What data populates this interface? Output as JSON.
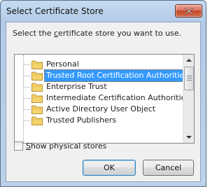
{
  "window": {
    "title": "Select Certificate Store"
  },
  "prompt": {
    "before": "Select the ",
    "underlined": "c",
    "after": "ertificate store you want to use."
  },
  "stores": [
    {
      "label": "Personal",
      "selected": false
    },
    {
      "label": "Trusted Root Certification Authorities",
      "selected": true
    },
    {
      "label": "Enterprise Trust",
      "selected": false
    },
    {
      "label": "Intermediate Certification Authorities",
      "selected": false
    },
    {
      "label": "Active Directory User Object",
      "selected": false
    },
    {
      "label": "Trusted Publishers",
      "selected": false
    }
  ],
  "show_physical": {
    "checked": false,
    "underlined": "S",
    "rest": "how physical stores"
  },
  "buttons": {
    "ok": "OK",
    "cancel": "Cancel"
  },
  "colors": {
    "selection": "#3399ff",
    "close_button": "#c14628",
    "folder": "#f5d36b"
  },
  "icons": {
    "close": "close-icon",
    "folder": "folder-icon",
    "scroll_up": "scroll-up-arrow-icon",
    "scroll_down": "scroll-down-arrow-icon"
  }
}
